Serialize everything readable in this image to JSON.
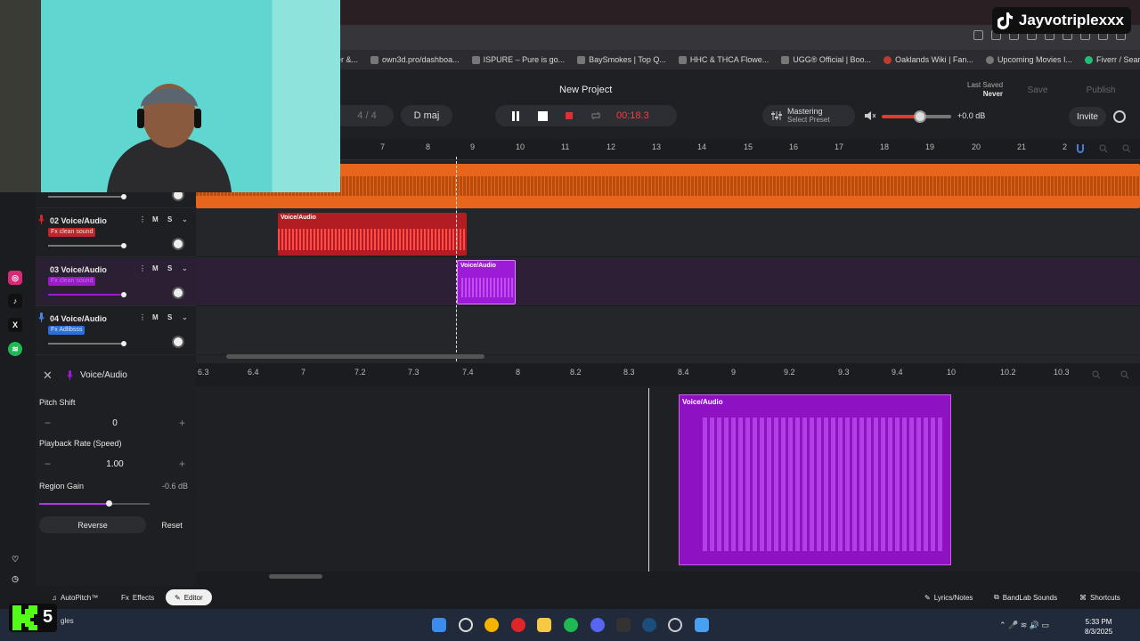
{
  "overlay": {
    "tiktok_handle": "Jayvotriplexxx",
    "badge_number": "5",
    "taskbar_text": "gles"
  },
  "browser": {
    "bookmarks": [
      "er &...",
      "own3d.pro/dashboa...",
      "ISPURE – Pure is go...",
      "BaySmokes | Top Q...",
      "HHC & THCA Flowe...",
      "UGG® Official | Boo...",
      "Oaklands Wiki | Fan...",
      "Upcoming Movies I...",
      "Fiverr / Search Resul..."
    ]
  },
  "header": {
    "project_title": "New Project",
    "time_signature": "4 / 4",
    "key": "D maj",
    "time": "00:18.3",
    "mastering_label": "Mastering",
    "mastering_preset": "Select Preset",
    "master_volume": "+0.0 dB",
    "last_saved_label": "Last Saved",
    "last_saved_value": "Never",
    "save_label": "Save",
    "publish_label": "Publish",
    "invite_label": "Invite"
  },
  "ruler": [
    "7",
    "8",
    "9",
    "10",
    "11",
    "12",
    "13",
    "14",
    "15",
    "16",
    "17",
    "18",
    "19",
    "20",
    "21",
    "2"
  ],
  "tracks": [
    {
      "number": "02",
      "name": "Voice/Audio",
      "fx": "Fx clean sound",
      "fx_color": "#c0252a"
    },
    {
      "number": "03",
      "name": "Voice/Audio",
      "fx": "Fx clean sound",
      "fx_color": "#9b1bc9"
    },
    {
      "number": "04",
      "name": "Voice/Audio",
      "fx": "Fx Adlibsss",
      "fx_color": "#2a6fd6"
    }
  ],
  "track_controls": {
    "mute": "M",
    "solo": "S"
  },
  "clips": {
    "red_clip_label": "Voice/Audio",
    "purple_clip_label": "Voice/Audio"
  },
  "editor": {
    "title": "Voice/Audio",
    "pitch_shift_label": "Pitch Shift",
    "pitch_shift_value": "0",
    "playback_rate_label": "Playback Rate (Speed)",
    "playback_rate_value": "1.00",
    "region_gain_label": "Region Gain",
    "region_gain_value": "-0.6 dB",
    "reverse_label": "Reverse",
    "reset_label": "Reset",
    "ruler": [
      "6.3",
      "6.4",
      "7",
      "7.2",
      "7.3",
      "7.4",
      "8",
      "8.2",
      "8.3",
      "8.4",
      "9",
      "9.2",
      "9.3",
      "9.4",
      "10",
      "10.2",
      "10.3"
    ],
    "clip_label": "Voice/Audio"
  },
  "bottom_bar": {
    "autopitch": "AutoPitch™",
    "effects": "Effects",
    "editor": "Editor",
    "lyrics": "Lyrics/Notes",
    "sounds": "BandLab Sounds",
    "shortcuts": "Shortcuts"
  },
  "clock": {
    "time": "5:33 PM",
    "date": "8/3/2025"
  },
  "colors": {
    "orange_track": "#e8661c",
    "red_clip": "#d4262b",
    "purple_clip": "#9b1bd6",
    "accent_red": "#ff3b3b"
  }
}
